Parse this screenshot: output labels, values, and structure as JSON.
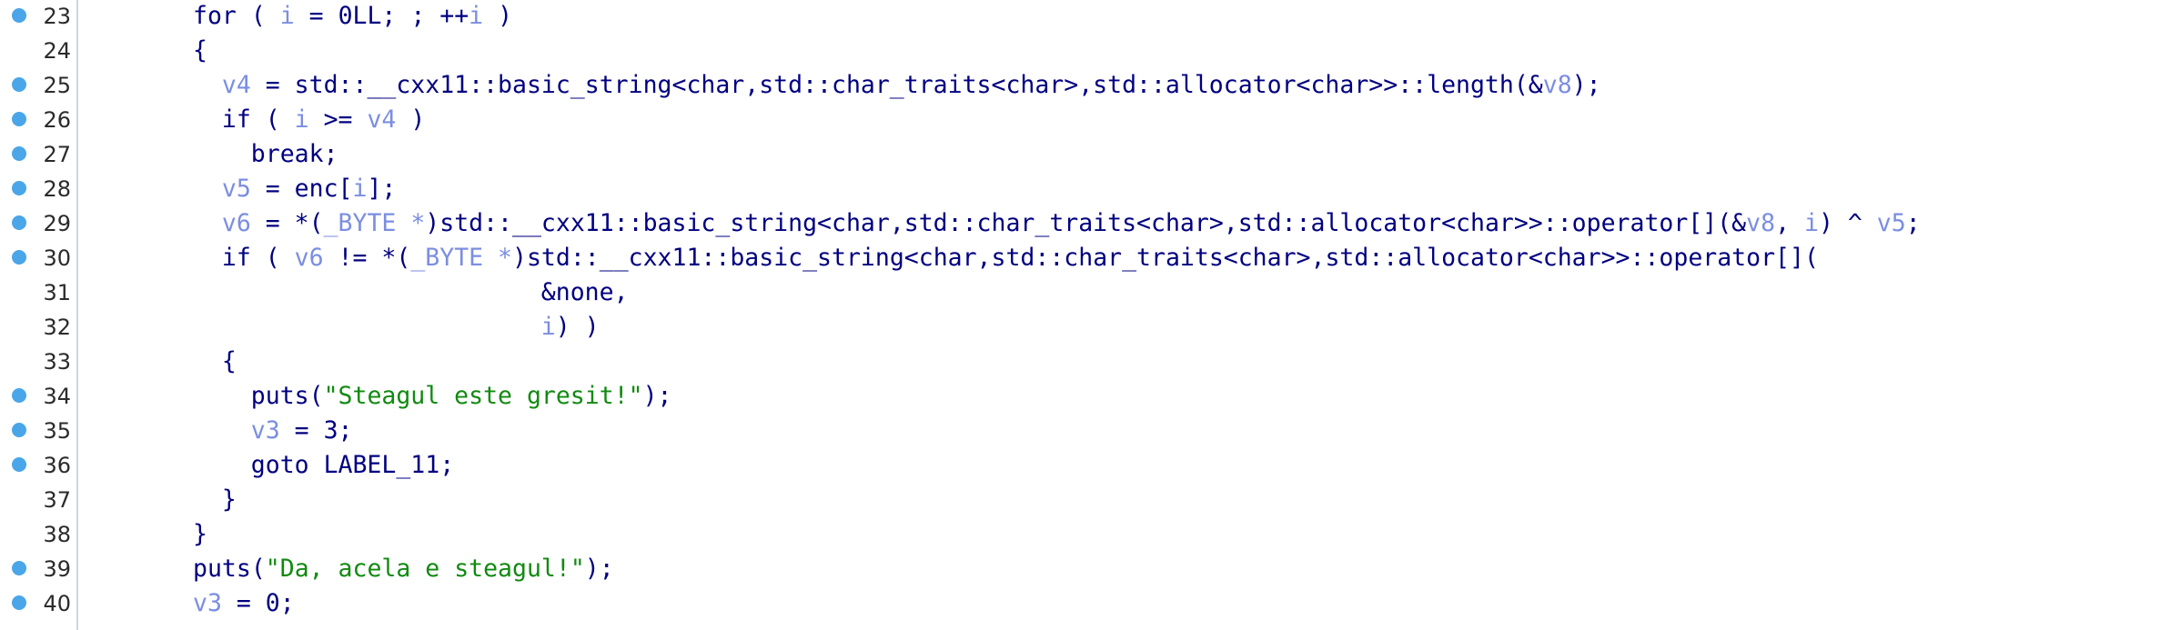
{
  "editor": {
    "lines": [
      {
        "num": "23",
        "bp": true,
        "indent": 0,
        "tokens": [
          {
            "t": "for ( ",
            "c": "kw"
          },
          {
            "t": "i",
            "c": "var"
          },
          {
            "t": " = 0LL; ; ++",
            "c": "op"
          },
          {
            "t": "i",
            "c": "var"
          },
          {
            "t": " )",
            "c": "op"
          }
        ]
      },
      {
        "num": "24",
        "bp": false,
        "indent": 0,
        "tokens": [
          {
            "t": "{",
            "c": "op"
          }
        ]
      },
      {
        "num": "25",
        "bp": true,
        "indent": 1,
        "tokens": [
          {
            "t": "v4",
            "c": "var"
          },
          {
            "t": " = std::__cxx11::basic_string<char,std::char_traits<char>,std::allocator<char>>::length(&",
            "c": "id"
          },
          {
            "t": "v8",
            "c": "var"
          },
          {
            "t": ");",
            "c": "op"
          }
        ]
      },
      {
        "num": "26",
        "bp": true,
        "indent": 1,
        "tokens": [
          {
            "t": "if ( ",
            "c": "kw"
          },
          {
            "t": "i",
            "c": "var"
          },
          {
            "t": " >= ",
            "c": "op"
          },
          {
            "t": "v4",
            "c": "var"
          },
          {
            "t": " )",
            "c": "op"
          }
        ]
      },
      {
        "num": "27",
        "bp": true,
        "indent": 2,
        "tokens": [
          {
            "t": "break;",
            "c": "kw"
          }
        ]
      },
      {
        "num": "28",
        "bp": true,
        "indent": 1,
        "tokens": [
          {
            "t": "v5",
            "c": "var"
          },
          {
            "t": " = enc[",
            "c": "id"
          },
          {
            "t": "i",
            "c": "var"
          },
          {
            "t": "];",
            "c": "op"
          }
        ]
      },
      {
        "num": "29",
        "bp": true,
        "indent": 1,
        "tokens": [
          {
            "t": "v6",
            "c": "var"
          },
          {
            "t": " = *(",
            "c": "op"
          },
          {
            "t": "_BYTE *",
            "c": "var"
          },
          {
            "t": ")std::__cxx11::basic_string<char,std::char_traits<char>,std::allocator<char>>::operator[](&",
            "c": "id"
          },
          {
            "t": "v8",
            "c": "var"
          },
          {
            "t": ", ",
            "c": "op"
          },
          {
            "t": "i",
            "c": "var"
          },
          {
            "t": ") ^ ",
            "c": "op"
          },
          {
            "t": "v5",
            "c": "var"
          },
          {
            "t": ";",
            "c": "op"
          }
        ]
      },
      {
        "num": "30",
        "bp": true,
        "indent": 1,
        "tokens": [
          {
            "t": "if ( ",
            "c": "kw"
          },
          {
            "t": "v6",
            "c": "var"
          },
          {
            "t": " != *(",
            "c": "op"
          },
          {
            "t": "_BYTE *",
            "c": "var"
          },
          {
            "t": ")std::__cxx11::basic_string<char,std::char_traits<char>,std::allocator<char>>::operator[](",
            "c": "id"
          }
        ]
      },
      {
        "num": "31",
        "bp": false,
        "indent": 12,
        "tokens": [
          {
            "t": "&none,",
            "c": "id"
          }
        ]
      },
      {
        "num": "32",
        "bp": false,
        "indent": 12,
        "tokens": [
          {
            "t": "i",
            "c": "var"
          },
          {
            "t": ") )",
            "c": "op"
          }
        ]
      },
      {
        "num": "33",
        "bp": false,
        "indent": 1,
        "tokens": [
          {
            "t": "{",
            "c": "op"
          }
        ]
      },
      {
        "num": "34",
        "bp": true,
        "indent": 2,
        "tokens": [
          {
            "t": "puts(",
            "c": "id"
          },
          {
            "t": "\"Steagul este gresit!\"",
            "c": "str"
          },
          {
            "t": ");",
            "c": "op"
          }
        ]
      },
      {
        "num": "35",
        "bp": true,
        "indent": 2,
        "tokens": [
          {
            "t": "v3",
            "c": "var"
          },
          {
            "t": " = 3;",
            "c": "op"
          }
        ]
      },
      {
        "num": "36",
        "bp": true,
        "indent": 2,
        "tokens": [
          {
            "t": "goto LABEL_11;",
            "c": "kw"
          }
        ]
      },
      {
        "num": "37",
        "bp": false,
        "indent": 1,
        "tokens": [
          {
            "t": "}",
            "c": "op"
          }
        ]
      },
      {
        "num": "38",
        "bp": false,
        "indent": 0,
        "tokens": [
          {
            "t": "}",
            "c": "op"
          }
        ]
      },
      {
        "num": "39",
        "bp": true,
        "indent": 0,
        "tokens": [
          {
            "t": "puts(",
            "c": "id"
          },
          {
            "t": "\"Da, acela e steagul!\"",
            "c": "str"
          },
          {
            "t": ");",
            "c": "op"
          }
        ]
      },
      {
        "num": "40",
        "bp": true,
        "indent": 0,
        "tokens": [
          {
            "t": "v3",
            "c": "var"
          },
          {
            "t": " = 0;",
            "c": "op"
          }
        ]
      }
    ]
  },
  "colors": {
    "breakpoint": "#4aa6e8",
    "identifier": "#000080",
    "variable": "#7b8ee0",
    "string": "#118a11",
    "line_number": "#2b2b2b"
  },
  "icons": {
    "breakpoint": "breakpoint-dot-icon"
  }
}
